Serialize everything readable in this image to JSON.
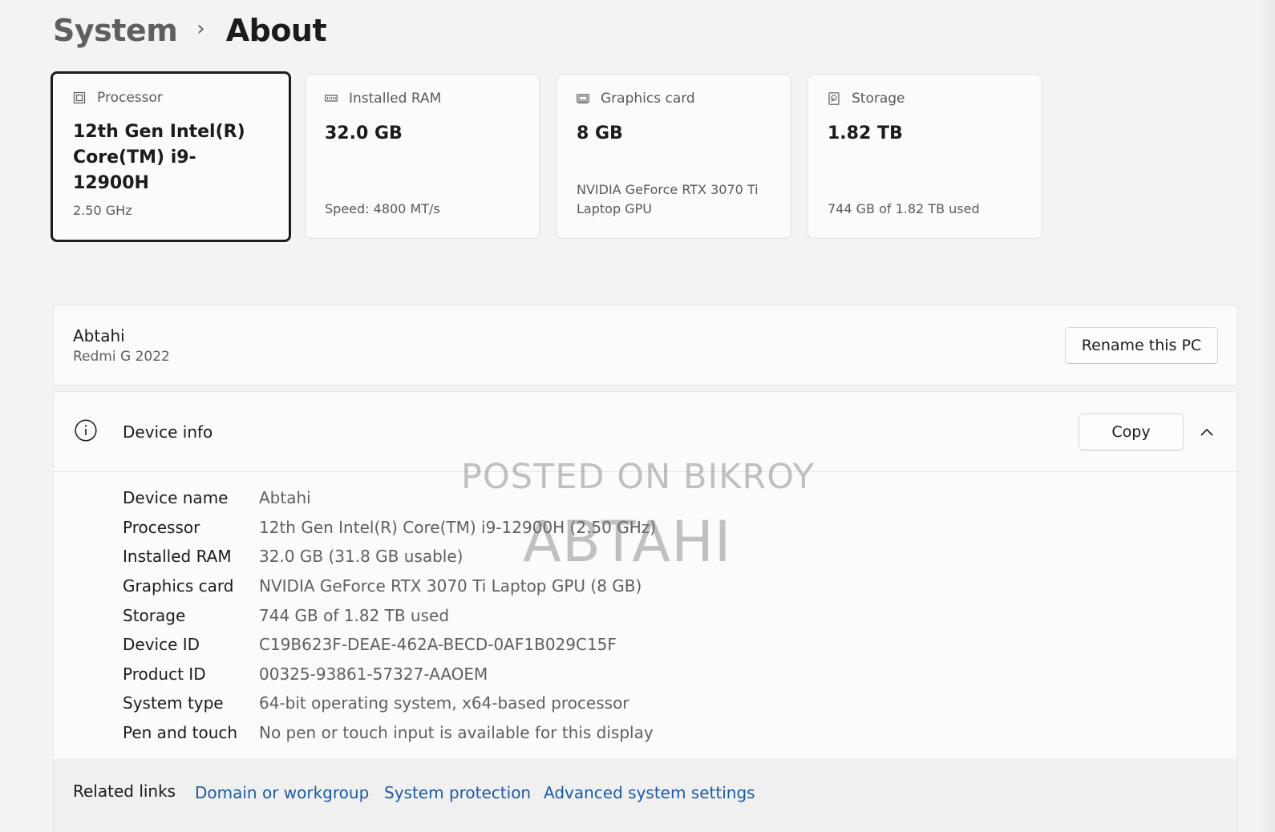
{
  "breadcrumb": {
    "parent": "System",
    "separator": "›",
    "current": "About"
  },
  "spec_cards": [
    {
      "icon": "processor-icon",
      "label": "Processor",
      "value": "12th Gen Intel(R) Core(TM) i9-12900H",
      "detail": "2.50 GHz",
      "selected": true
    },
    {
      "icon": "ram-icon",
      "label": "Installed RAM",
      "value": "32.0 GB",
      "detail": "Speed: 4800 MT/s"
    },
    {
      "icon": "graphics-card-icon",
      "label": "Graphics card",
      "value": "8 GB",
      "detail": "NVIDIA GeForce RTX 3070 Ti Laptop GPU"
    },
    {
      "icon": "storage-icon",
      "label": "Storage",
      "value": "1.82 TB",
      "detail": "744 GB of 1.82 TB used"
    }
  ],
  "pc": {
    "name": "Abtahi",
    "model": "Redmi G 2022",
    "rename_label": "Rename this PC"
  },
  "device_info": {
    "title": "Device info",
    "copy_label": "Copy",
    "rows": [
      {
        "label": "Device name",
        "value": "Abtahi"
      },
      {
        "label": "Processor",
        "value": "12th Gen Intel(R) Core(TM) i9-12900H (2.50 GHz)"
      },
      {
        "label": "Installed RAM",
        "value": "32.0 GB (31.8 GB usable)"
      },
      {
        "label": "Graphics card",
        "value": "NVIDIA GeForce RTX 3070 Ti Laptop GPU (8 GB)"
      },
      {
        "label": "Storage",
        "value": "744 GB of 1.82 TB used"
      },
      {
        "label": "Device ID",
        "value": "C19B623F-DEAE-462A-BECD-0AF1B029C15F"
      },
      {
        "label": "Product ID",
        "value": "00325-93861-57327-AAOEM"
      },
      {
        "label": "System type",
        "value": "64-bit operating system, x64-based processor"
      },
      {
        "label": "Pen and touch",
        "value": "No pen or touch input is available for this display"
      }
    ]
  },
  "watermark": {
    "line1": "POSTED ON BIKROY",
    "line2": "ABTAHI"
  },
  "related_links": {
    "label": "Related links",
    "links": [
      "Domain or workgroup",
      "System protection",
      "Advanced system settings"
    ]
  },
  "colors": {
    "background": "#f3f3f3",
    "card": "#fbfbfb",
    "link": "#1a5aa6",
    "selected_border": "#1b1b1b"
  }
}
